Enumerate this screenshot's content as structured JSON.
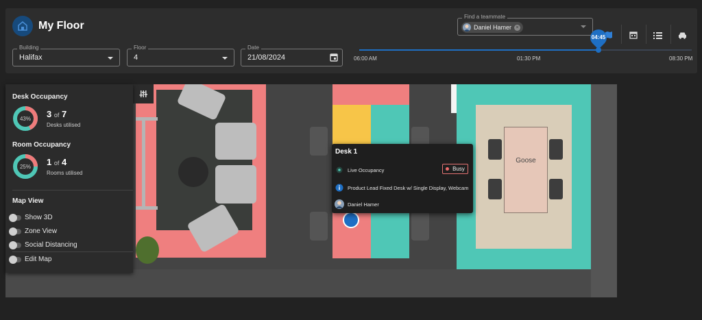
{
  "header": {
    "title": "My Floor",
    "building": {
      "label": "Building",
      "value": "Halifax"
    },
    "floor": {
      "label": "Floor",
      "value": "4"
    },
    "date": {
      "label": "Date",
      "value": "21/08/2024"
    },
    "find_teammate": {
      "label": "Find a teammate",
      "chip": "Daniel Hamer"
    },
    "tools": [
      "map-icon",
      "calendar-icon",
      "list-icon",
      "car-icon"
    ],
    "accent": "#1e6fc4"
  },
  "timeline": {
    "current": "04:45",
    "labels": [
      "06:00 AM",
      "01:30 PM",
      "08:30 PM"
    ],
    "progress": 0.72
  },
  "panel": {
    "desk": {
      "title": "Desk Occupancy",
      "percent_label": "43%",
      "percent": 43,
      "count": "3",
      "of": "of",
      "total": "7",
      "sub": "Desks utilised"
    },
    "room": {
      "title": "Room Occupancy",
      "percent_label": "25%",
      "percent": 25,
      "count": "1",
      "of": "of",
      "total": "4",
      "sub": "Rooms utilised"
    },
    "map_view": {
      "title": "Map View",
      "toggles": [
        "Show 3D",
        "Zone View",
        "Social Distancing",
        "Edit Map"
      ]
    }
  },
  "popup": {
    "title": "Desk 1",
    "occupancy": "Live Occupancy",
    "status": "Busy",
    "description": "Product Lead Fixed Desk w/ Single Display, Webcam",
    "person": "Daniel Hamer"
  },
  "map": {
    "room_label": "Goose"
  },
  "colors": {
    "busy": "#ef6b6b",
    "donut_fill": "#ef7b7b",
    "donut_rest": "#4fc7b6",
    "zone_salmon": "#ef7f7f",
    "zone_teal": "#4fc7b6",
    "zone_yellow": "#f7c548"
  }
}
